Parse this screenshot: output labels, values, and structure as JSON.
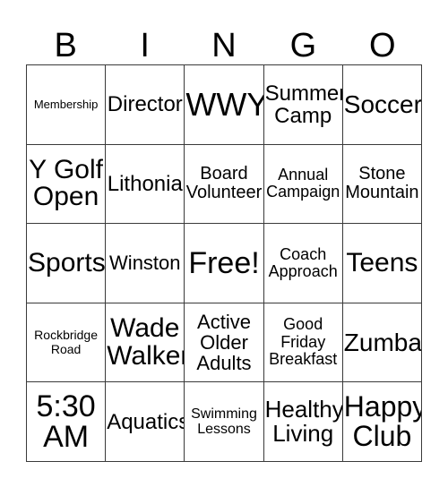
{
  "card": {
    "header_letters": [
      "B",
      "I",
      "N",
      "G",
      "O"
    ],
    "grid_rows": 5,
    "grid_cols": 5,
    "border_color": "#3a3a3a",
    "background_color": "#ffffff",
    "text_color": "#000000",
    "cells": [
      {
        "text": "Membership",
        "size": 13
      },
      {
        "text": "Director",
        "size": 24
      },
      {
        "text": "WWY",
        "size": 36
      },
      {
        "text": "Summer\nCamp",
        "size": 24
      },
      {
        "text": "Soccer",
        "size": 28
      }
    ],
    "rows": [
      [
        {
          "text": "Membership",
          "size": 13
        },
        {
          "text": "Director",
          "size": 24
        },
        {
          "text": "WWY",
          "size": 36
        },
        {
          "text": "Summer\nCamp",
          "size": 24
        },
        {
          "text": "Soccer",
          "size": 28
        }
      ],
      [
        {
          "text": "Y Golf\nOpen",
          "size": 30
        },
        {
          "text": "Lithonia",
          "size": 24
        },
        {
          "text": "Board\nVolunteer",
          "size": 20
        },
        {
          "text": "Annual\nCampaign",
          "size": 18
        },
        {
          "text": "Stone\nMountain",
          "size": 20
        }
      ],
      [
        {
          "text": "Sports",
          "size": 30
        },
        {
          "text": "Winston",
          "size": 22
        },
        {
          "text": "Free!",
          "size": 34
        },
        {
          "text": "Coach\nApproach",
          "size": 18
        },
        {
          "text": "Teens",
          "size": 30
        }
      ],
      [
        {
          "text": "Rockbridge\nRoad",
          "size": 14
        },
        {
          "text": "Wade\nWalker",
          "size": 30
        },
        {
          "text": "Active\nOlder\nAdults",
          "size": 22
        },
        {
          "text": "Good\nFriday\nBreakfast",
          "size": 18
        },
        {
          "text": "Zumba",
          "size": 28
        }
      ],
      [
        {
          "text": "5:30\nAM",
          "size": 34
        },
        {
          "text": "Aquatics",
          "size": 24
        },
        {
          "text": "Swimming\nLessons",
          "size": 16
        },
        {
          "text": "Healthy\nLiving",
          "size": 26
        },
        {
          "text": "Happy\nClub",
          "size": 32
        }
      ]
    ]
  }
}
